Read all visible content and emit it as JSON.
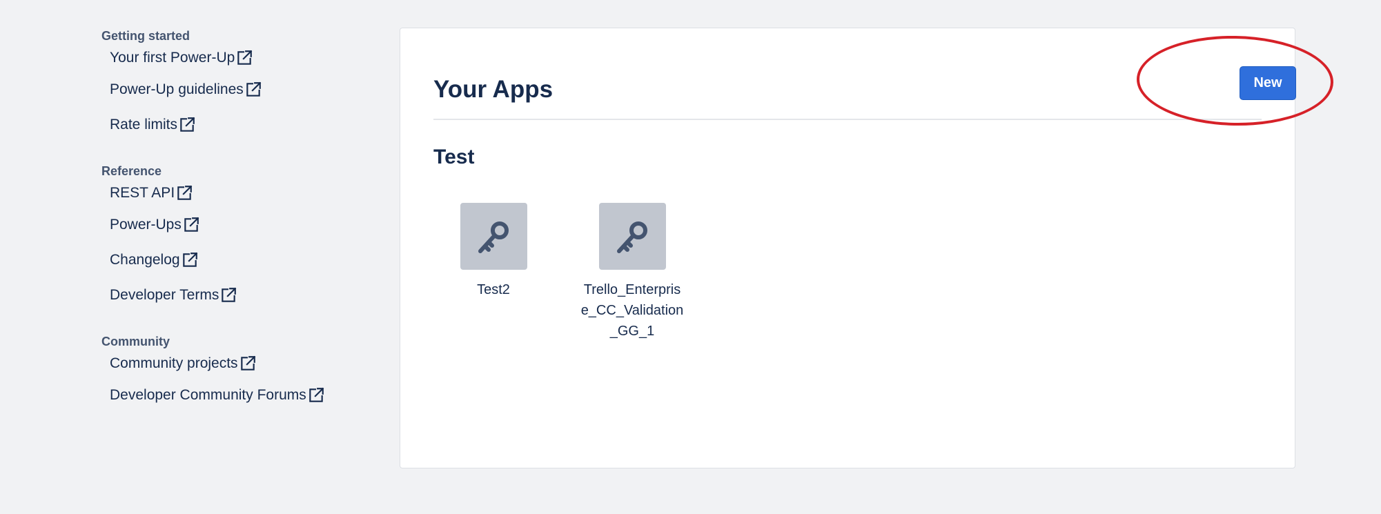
{
  "sidebar": {
    "sections": [
      {
        "title": "Getting started",
        "items": [
          "Your first Power-Up",
          "Power-Up guidelines",
          "Rate limits"
        ]
      },
      {
        "title": "Reference",
        "items": [
          "REST API",
          "Power-Ups",
          "Changelog",
          "Developer Terms"
        ]
      },
      {
        "title": "Community",
        "items": [
          "Community projects",
          "Developer Community Forums"
        ]
      }
    ],
    "item_icon": "external-link-icon"
  },
  "main": {
    "title": "Your Apps",
    "new_button_label": "New",
    "group_title": "Test",
    "apps": [
      {
        "name": "Test2",
        "icon": "key-icon"
      },
      {
        "name": "Trello_Enterprise_CC_Validation_GG_1",
        "icon": "key-icon"
      }
    ]
  },
  "annotation": {
    "color": "#d62128",
    "shape": "ellipse"
  },
  "colors": {
    "accent": "#2f6fdc",
    "background": "#f1f2f4",
    "app_icon_bg": "#c1c6cf"
  }
}
